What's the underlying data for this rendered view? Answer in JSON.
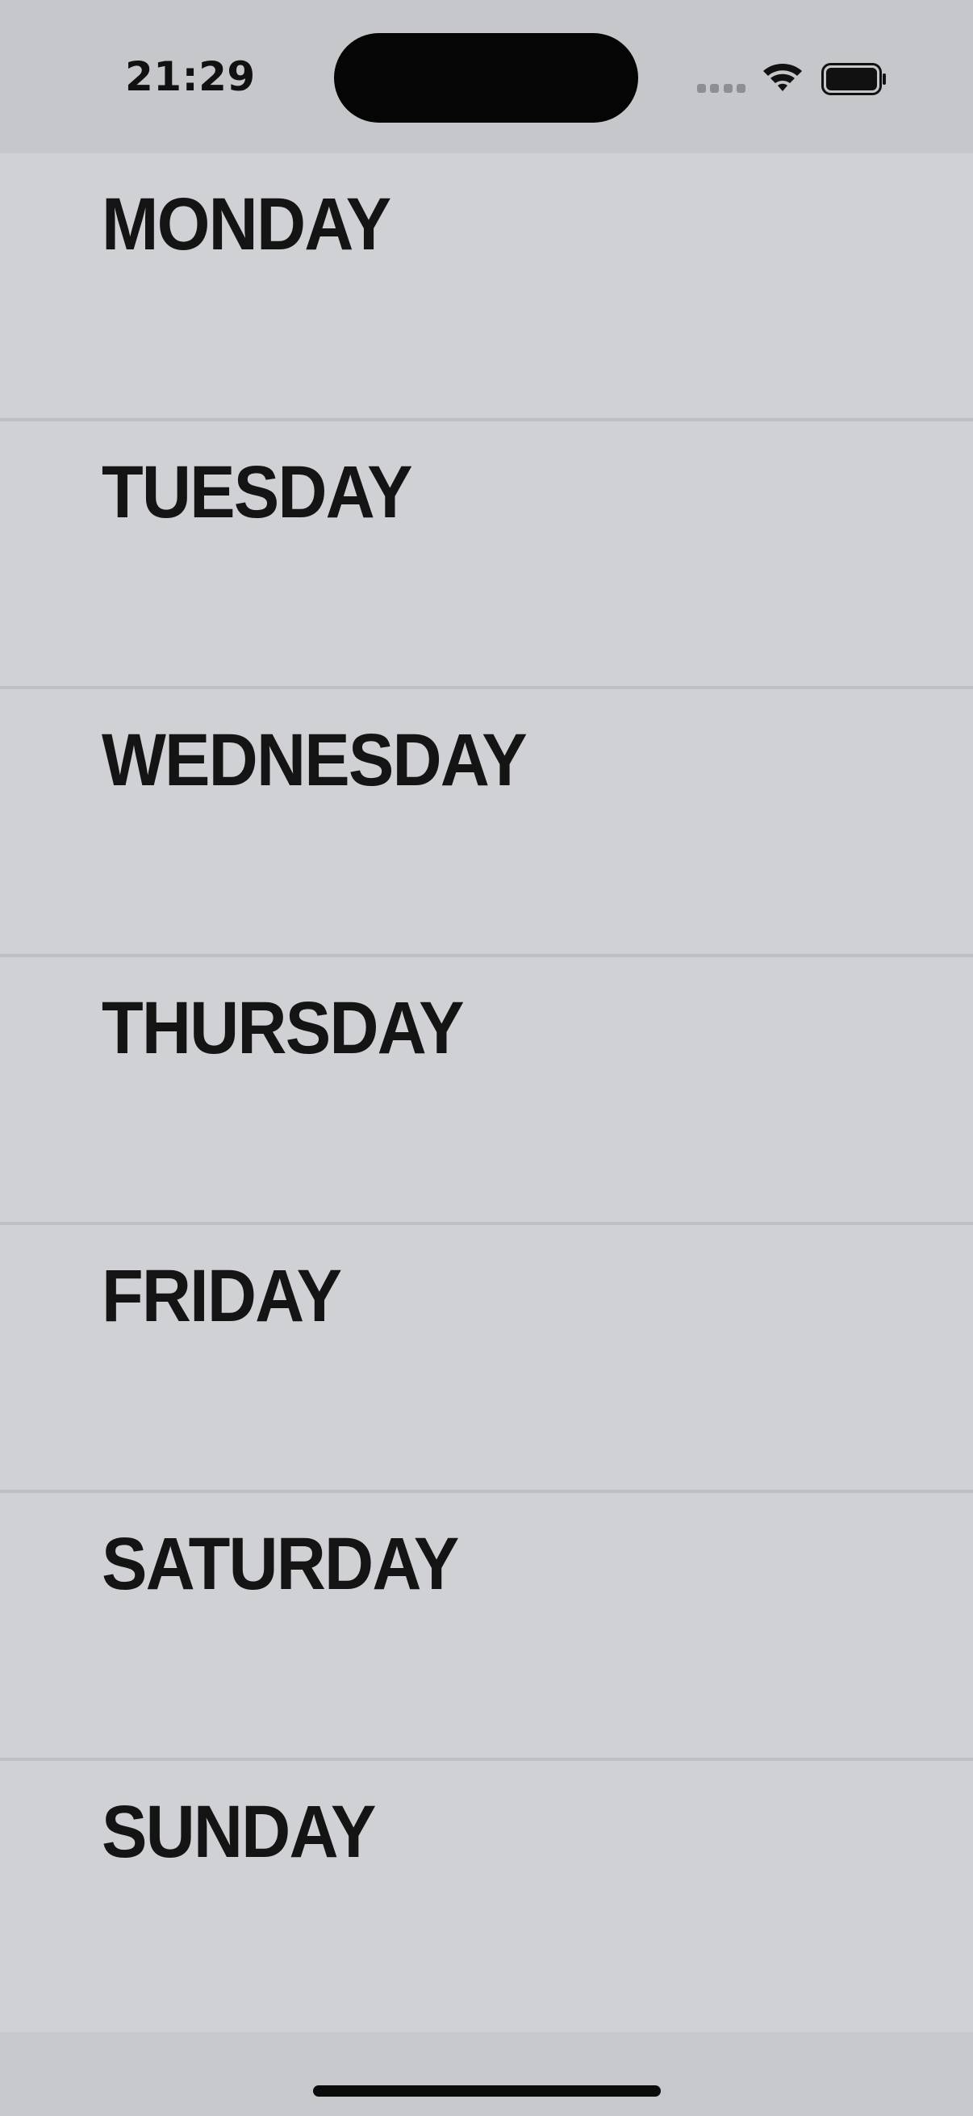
{
  "status_bar": {
    "time": "21:29",
    "icons": [
      "cellular-signal-icon",
      "wifi-icon",
      "battery-icon"
    ]
  },
  "days": [
    {
      "label": "MONDAY"
    },
    {
      "label": "TUESDAY"
    },
    {
      "label": "WEDNESDAY"
    },
    {
      "label": "THURSDAY"
    },
    {
      "label": "FRIDAY"
    },
    {
      "label": "SATURDAY"
    },
    {
      "label": "SUNDAY"
    }
  ],
  "colors": {
    "background": "#c6c8cc",
    "row_background": "#cfd1d5",
    "divider": "#bdbfc3",
    "text": "#141414"
  }
}
